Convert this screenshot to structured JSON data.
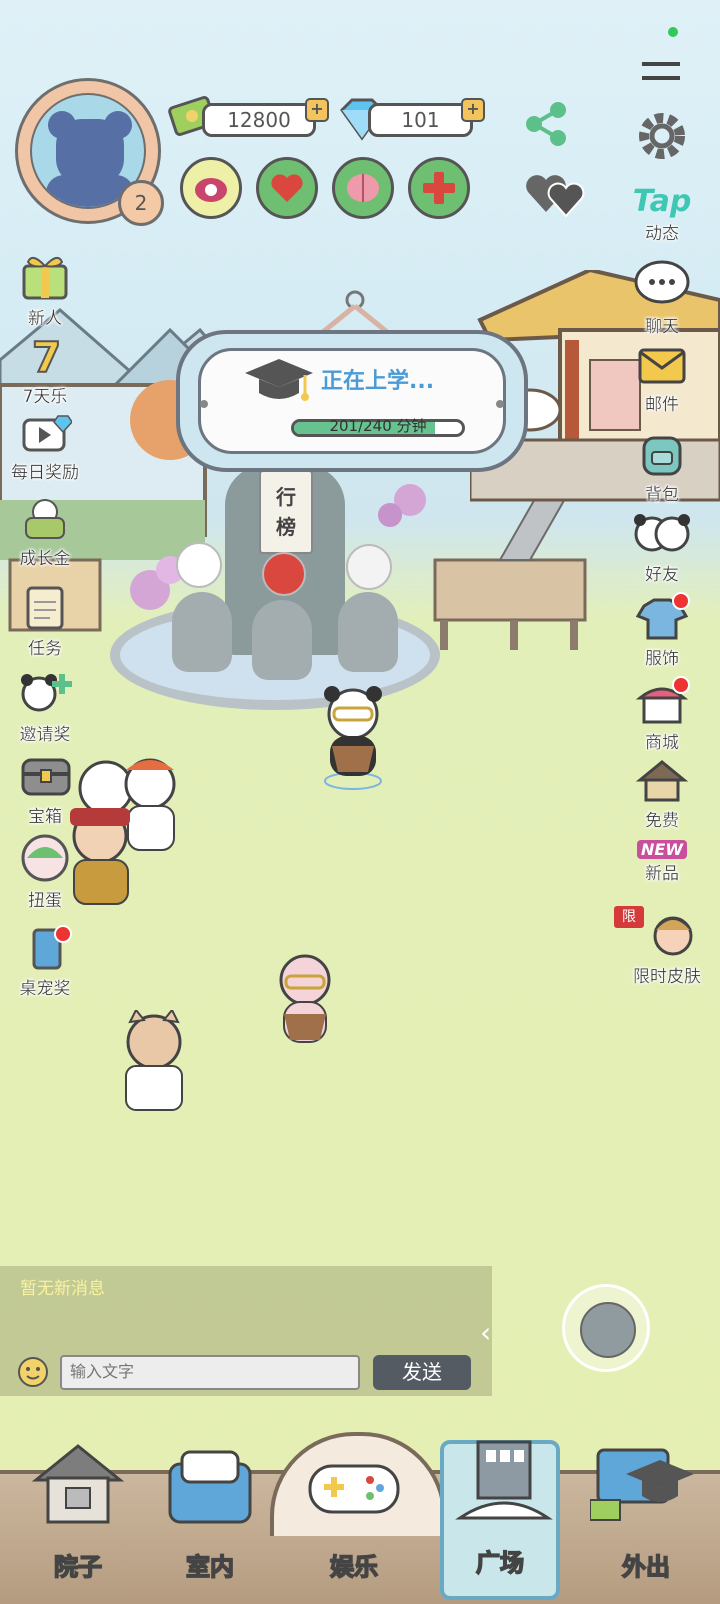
{
  "resources": {
    "coins": "12800",
    "diamonds": "101"
  },
  "player": {
    "level": "2"
  },
  "top_right": {
    "tap_logo": "Tap",
    "tap_label": "动态"
  },
  "school_banner": {
    "status": "正在上学...",
    "progress_text": "201/240 分钟",
    "progress_fraction": 0.8375
  },
  "monument_text": [
    "行",
    "榜"
  ],
  "left_menu": [
    {
      "label": "新人"
    },
    {
      "label": "7天乐"
    },
    {
      "label": "每日奖励"
    },
    {
      "label": "成长金"
    },
    {
      "label": "任务"
    },
    {
      "label": "邀请奖"
    },
    {
      "label": "宝箱"
    },
    {
      "label": "扭蛋"
    },
    {
      "label": "桌宠奖"
    }
  ],
  "right_menu": [
    {
      "label": "聊天"
    },
    {
      "label": "邮件"
    },
    {
      "label": "背包"
    },
    {
      "label": "好友"
    },
    {
      "label": "服饰"
    },
    {
      "label": "商城"
    },
    {
      "label": "免费"
    },
    {
      "label": "新品",
      "badge": "NEW"
    },
    {
      "label": "限时皮肤",
      "badge": "限"
    }
  ],
  "chat": {
    "message": "暂无新消息",
    "placeholder": "输入文字",
    "send_label": "发送"
  },
  "bottom_nav": [
    {
      "label": "院子"
    },
    {
      "label": "室内"
    },
    {
      "label": "娱乐"
    },
    {
      "label": "广场"
    },
    {
      "label": "外出"
    }
  ],
  "colors": {
    "ground": "#e5efb3",
    "sky": "#dff1f7",
    "progress": "#66c28e",
    "send": "#545b62"
  }
}
